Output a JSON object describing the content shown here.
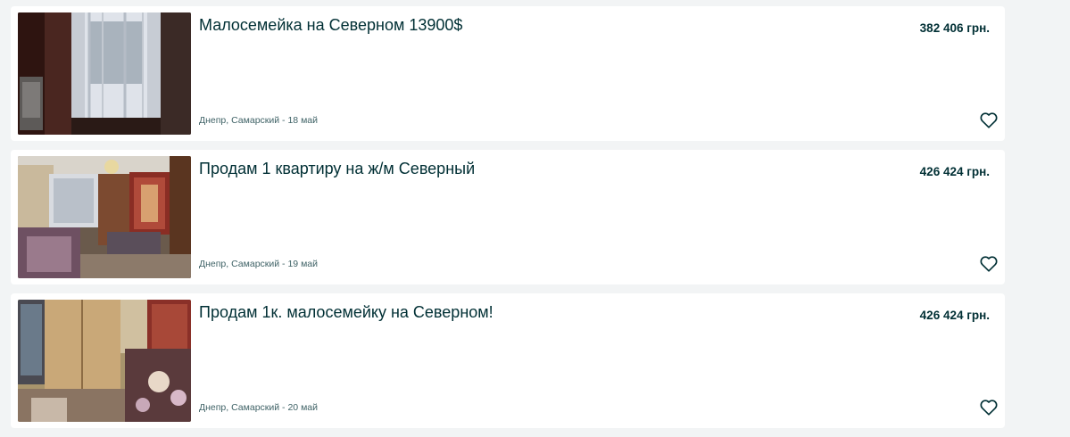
{
  "listings": [
    {
      "title": "Малосемейка на Северном 13900$",
      "price": "382 406 грн.",
      "location": "Днепр, Самарский",
      "separator": " - ",
      "date": "18 май",
      "photo_icon": "apartment-photo",
      "favorite_icon": "heart-outline-icon"
    },
    {
      "title": "Продам 1 квартиру на ж/м Северный",
      "price": "426 424 грн.",
      "location": "Днепр, Самарский",
      "separator": " - ",
      "date": "19 май",
      "photo_icon": "apartment-photo",
      "favorite_icon": "heart-outline-icon"
    },
    {
      "title": "Продам 1к. малосемейку на Северном!",
      "price": "426 424 грн.",
      "location": "Днепр, Самарский",
      "separator": " - ",
      "date": "20 май",
      "photo_icon": "apartment-photo",
      "favorite_icon": "heart-outline-icon"
    }
  ],
  "colors": {
    "page_background": "#f2f4f5",
    "card_background": "#ffffff",
    "title_text": "#002f34",
    "meta_text": "#406367"
  }
}
